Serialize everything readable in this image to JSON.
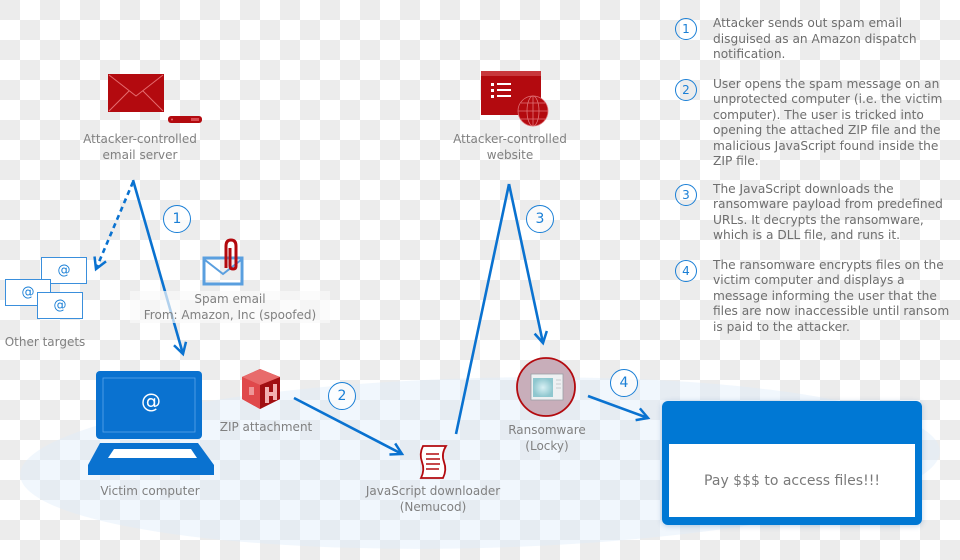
{
  "nodes": {
    "email_server": {
      "line1": "Attacker-controlled",
      "line2": "email server"
    },
    "website": {
      "line1": "Attacker-controlled",
      "line2": "website"
    },
    "other_targets": {
      "label": "Other targets",
      "at_symbol": "@"
    },
    "spam_email": {
      "line1": "Spam email",
      "line2": "From: Amazon, Inc (spoofed)"
    },
    "victim_computer": {
      "label": "Victim computer",
      "screen_symbol": "@"
    },
    "zip_attachment": {
      "label": "ZIP attachment"
    },
    "js_downloader": {
      "line1": "JavaScript downloader",
      "line2": "(Nemucod)"
    },
    "ransomware": {
      "line1": "Ransomware",
      "line2": "(Locky)"
    },
    "ransom_window": {
      "message": "Pay $$$ to access files!!!"
    }
  },
  "flow_markers": [
    "1",
    "2",
    "3",
    "4"
  ],
  "steps": [
    {
      "number": "1",
      "text": "Attacker sends out spam email disguised as an Amazon dispatch notification."
    },
    {
      "number": "2",
      "text": "User opens the spam message on an unprotected computer (i.e. the victim computer). The user is tricked into opening the attached ZIP file and the malicious JavaScript found inside the ZIP file."
    },
    {
      "number": "3",
      "text": "The JavaScript downloads the ransomware payload from predefined URLs. It decrypts the ransomware, which is a DLL file, and runs it."
    },
    {
      "number": "4",
      "text": "The ransomware encrypts files on the victim computer and displays a message informing the user that the files are now inaccessible until ransom is paid to the attacker."
    }
  ],
  "colors": {
    "accent_blue": "#0078d4",
    "threat_red": "#b50d14",
    "label_gray": "#808080"
  }
}
